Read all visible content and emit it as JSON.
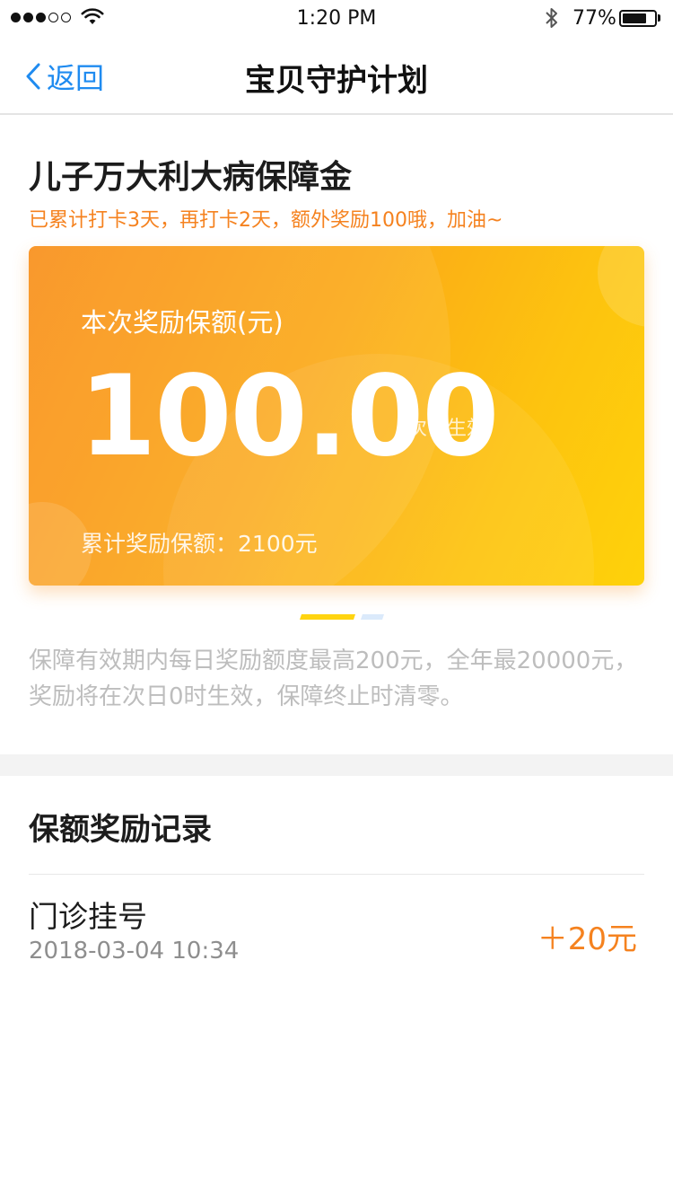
{
  "status_bar": {
    "time": "1:20 PM",
    "battery_percent": "77%",
    "battery_level": 0.77,
    "signal_bars_filled": 3,
    "signal_bars_total": 5,
    "icons": [
      "signal-dots-icon",
      "wifi-icon",
      "bluetooth-icon",
      "battery-icon"
    ]
  },
  "nav": {
    "back_label": "返回",
    "title": "宝贝守护计划",
    "accent_color": "#1f8bf0"
  },
  "plan": {
    "title": "儿子万大利大病保障金",
    "subtitle": "已累计打卡3天，再打卡2天，额外奖励100哦，加油~",
    "subtitle_color": "#f5821f"
  },
  "card": {
    "label": "本次奖励保额(元)",
    "amount": "100.00",
    "note": "次日生效",
    "total_label": "累计奖励保额：",
    "total_value": "2100元",
    "gradient_start": "#f9901c",
    "gradient_end": "#fed20a"
  },
  "carousel": {
    "page_count": 2,
    "active_index": 0
  },
  "description": "保障有效期内每日奖励额度最高200元，全年最20000元，奖励将在次日0时生效，保障终止时清零。",
  "records": {
    "title": "保额奖励记录",
    "items": [
      {
        "name": "门诊挂号",
        "time": "2018-03-04 10:34",
        "amount": "＋20元"
      }
    ]
  }
}
